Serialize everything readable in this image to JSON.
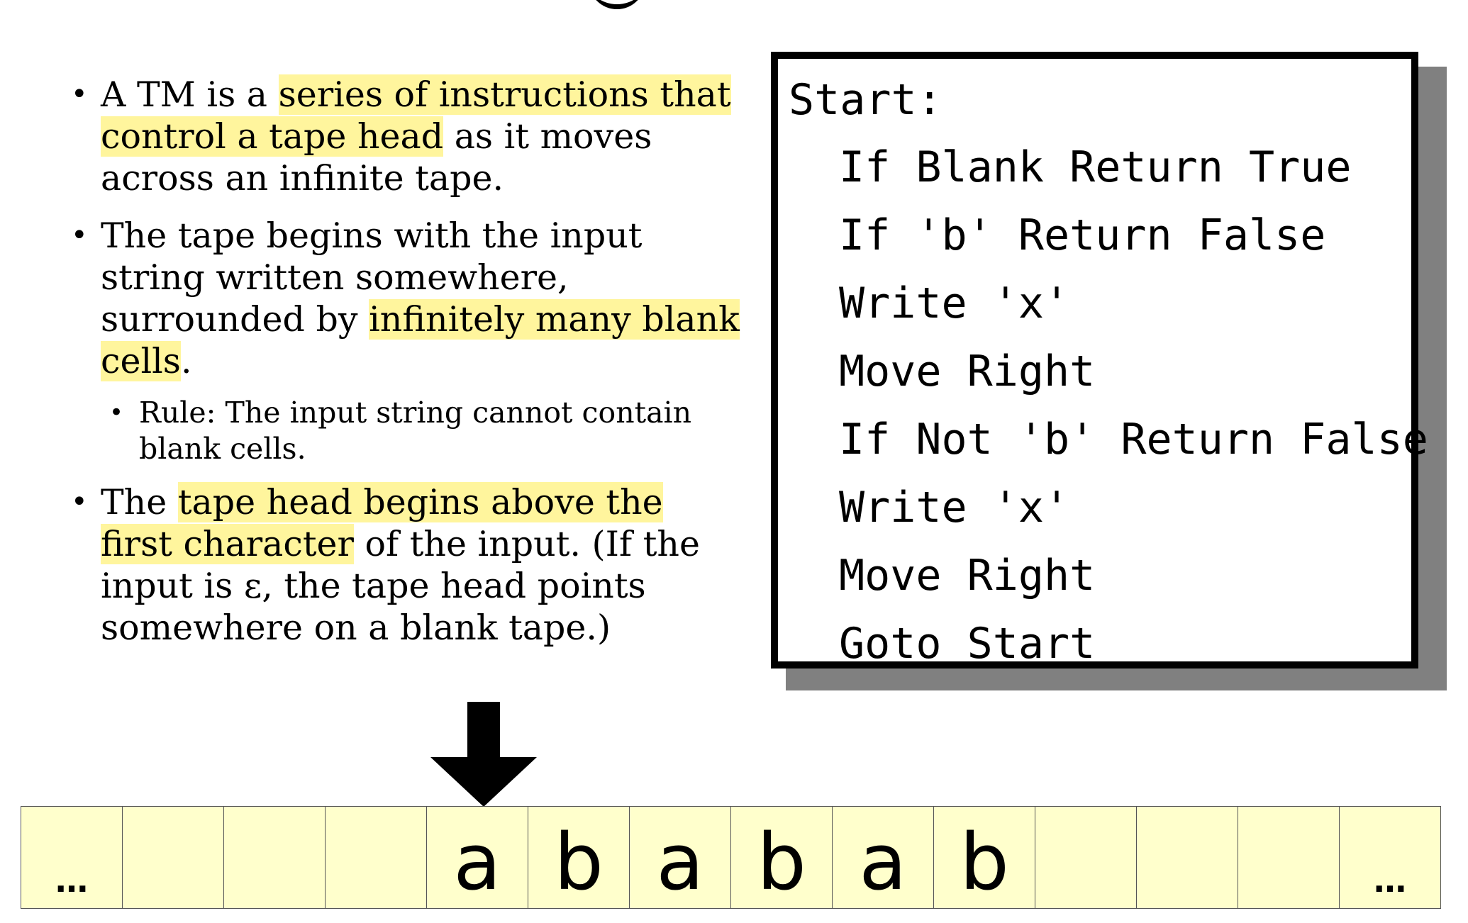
{
  "bullets": {
    "b1": {
      "pre": "A TM is a ",
      "hl": "series of instructions that control a tape head",
      "post": " as it moves across an infinite tape."
    },
    "b2": {
      "pre": "The tape begins with the input string written somewhere, surrounded by ",
      "hl": "infinitely many blank cells",
      "post": "."
    },
    "sub": {
      "text": "Rule: The input string cannot contain blank cells."
    },
    "b3": {
      "pre": "The ",
      "hl": "tape head begins above the first character",
      "post": " of the input. (If the input is ε, the tape head points somewhere on a blank tape.)"
    }
  },
  "program": {
    "lines": [
      "Start:",
      "If Blank Return True",
      "If 'b' Return False",
      "Write 'x'",
      "Move Right",
      "If Not 'b' Return False",
      "Write 'x'",
      "Move Right",
      "Goto Start"
    ]
  },
  "tape": {
    "cells": [
      "…",
      "",
      "",
      "",
      "a",
      "b",
      "a",
      "b",
      "a",
      "b",
      "",
      "",
      "",
      "…"
    ],
    "head_index": 4
  },
  "colors": {
    "highlight": "#fff59d",
    "tape_cell": "#ffffcc",
    "shadow": "#808080"
  }
}
